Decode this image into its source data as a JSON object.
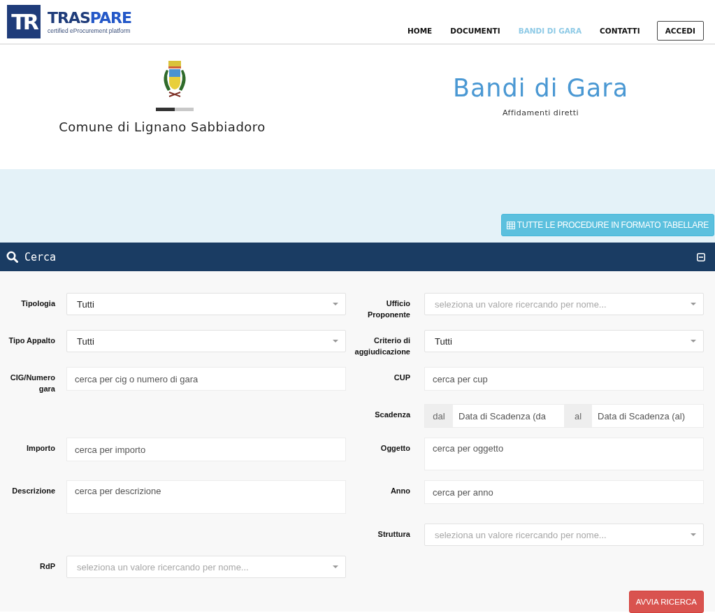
{
  "header": {
    "logo": {
      "mark": "TR",
      "name_parts": [
        "TRAS",
        "PARE"
      ],
      "tagline": "certified eProcurement platform"
    },
    "nav": [
      {
        "label": "HOME",
        "selected": false
      },
      {
        "label": "DOCUMENTI",
        "selected": false
      },
      {
        "label": "BANDI DI GARA",
        "selected": true
      },
      {
        "label": "CONTATTI",
        "selected": false
      }
    ],
    "login_button": "ACCEDI"
  },
  "hero": {
    "organization": "Comune di Lignano Sabbiadoro",
    "title": "Bandi di Gara",
    "subtitle": "Affidamenti diretti"
  },
  "table_view_button": "TUTTE LE PROCEDURE IN FORMATO TABELLARE",
  "search_panel": {
    "title": "Cerca",
    "rows": [
      {
        "left": {
          "label": "Tipologia",
          "kind": "select",
          "value": "Tutti"
        },
        "right": {
          "label": "Ufficio Proponente",
          "kind": "select",
          "placeholder": "seleziona un valore ricercando per nome..."
        }
      },
      {
        "left": {
          "label": "Tipo Appalto",
          "kind": "select",
          "value": "Tutti"
        },
        "right": {
          "label": "Criterio di aggiudicazione",
          "kind": "select",
          "value": "Tutti"
        }
      },
      {
        "left": {
          "label": "CIG/Numero gara",
          "kind": "text",
          "placeholder": "cerca per cig o numero di gara"
        },
        "right": {
          "label": "CUP",
          "kind": "text",
          "placeholder": "cerca per cup"
        }
      },
      {
        "right": {
          "label": "Scadenza",
          "kind": "daterange",
          "from_addon": "dal",
          "from_placeholder": "Data di Scadenza (da",
          "to_addon": "al",
          "to_placeholder": "Data di Scadenza (al)"
        }
      },
      {
        "left": {
          "label": "Importo",
          "kind": "text",
          "placeholder": "cerca per importo"
        },
        "right": {
          "label": "Oggetto",
          "kind": "textarea",
          "placeholder": "cerca per oggetto"
        }
      },
      {
        "left": {
          "label": "Descrizione",
          "kind": "textarea",
          "placeholder": "cerca per descrizione"
        },
        "right": {
          "label": "Anno",
          "kind": "text",
          "placeholder": "cerca per anno"
        }
      },
      {
        "right": {
          "label": "Struttura",
          "kind": "select",
          "placeholder": "seleziona un valore ricercando per nome..."
        }
      },
      {
        "left": {
          "label": "RdP",
          "kind": "select",
          "placeholder": "seleziona un valore ricercando per nome..."
        }
      }
    ],
    "submit_button": "AVVIA RICERCA"
  }
}
